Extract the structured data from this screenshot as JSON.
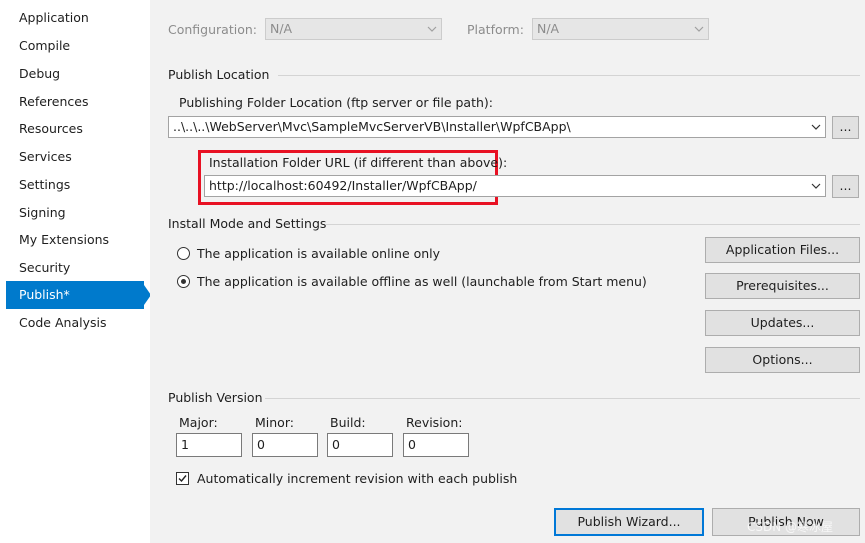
{
  "sidebar": {
    "items": [
      {
        "label": "Application"
      },
      {
        "label": "Compile"
      },
      {
        "label": "Debug"
      },
      {
        "label": "References"
      },
      {
        "label": "Resources"
      },
      {
        "label": "Services"
      },
      {
        "label": "Settings"
      },
      {
        "label": "Signing"
      },
      {
        "label": "My Extensions"
      },
      {
        "label": "Security"
      },
      {
        "label": "Publish*"
      },
      {
        "label": "Code Analysis"
      }
    ],
    "active_index": 10
  },
  "header": {
    "configuration_label": "Configuration:",
    "configuration_value": "N/A",
    "platform_label": "Platform:",
    "platform_value": "N/A"
  },
  "publish_location": {
    "title": "Publish Location",
    "folder_label": "Publishing Folder Location (ftp server or file path):",
    "folder_value": "..\\..\\..\\WebServer\\Mvc\\SampleMvcServerVB\\Installer\\WpfCBApp\\",
    "browse_label": "...",
    "install_url_label": "Installation Folder URL (if different than above):",
    "install_url_value": "http://localhost:60492/Installer/WpfCBApp/",
    "browse2_label": "..."
  },
  "install_mode": {
    "title": "Install Mode and Settings",
    "option_online": "The application is available online only",
    "option_offline": "The application is available offline as well (launchable from Start menu)",
    "selected": "offline",
    "buttons": {
      "application_files": "Application Files...",
      "prerequisites": "Prerequisites...",
      "updates": "Updates...",
      "options": "Options..."
    }
  },
  "publish_version": {
    "title": "Publish Version",
    "major_label": "Major:",
    "minor_label": "Minor:",
    "build_label": "Build:",
    "revision_label": "Revision:",
    "major": "1",
    "minor": "0",
    "build": "0",
    "revision": "0",
    "auto_increment_label": "Automatically increment revision with each publish",
    "auto_increment_checked": true
  },
  "footer": {
    "publish_wizard": "Publish Wizard...",
    "publish_now": "Publish Now",
    "watermark": "CSDN @寒冰屋"
  },
  "colors": {
    "accent": "#007acc",
    "highlight_border": "#e81123",
    "panel_bg": "#f2f2f2"
  }
}
